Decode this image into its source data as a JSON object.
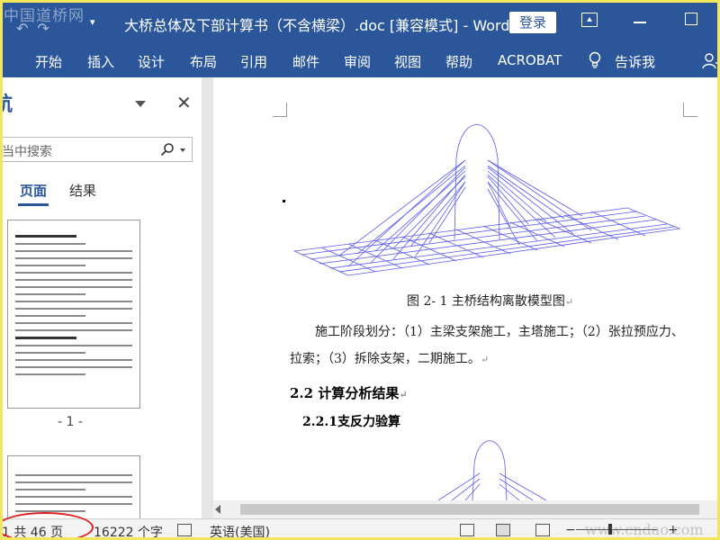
{
  "window": {
    "title": "大桥总体及下部计算书（不含横梁）.doc [兼容模式]  -  Word",
    "login_label": "登录",
    "watermark_logo": "中国道桥网"
  },
  "ribbon": {
    "tabs": [
      "开始",
      "插入",
      "设计",
      "布局",
      "引用",
      "邮件",
      "审阅",
      "视图",
      "帮助",
      "ACROBAT"
    ],
    "tell_me": "告诉我"
  },
  "nav_pane": {
    "title": "航",
    "search_placeholder": "当中搜索",
    "tabs": [
      "页面",
      "结果"
    ],
    "page_number_label": "- 1 -"
  },
  "document": {
    "figure_caption": "图 2- 1 主桥结构离散模型图",
    "paragraph_line1": "施工阶段划分：（1）主梁支架施工，主塔施工；（2）张拉预应力、",
    "paragraph_line2": "拉索；（3）拆除支架，二期施工。",
    "heading_2": "2.2 计算分析结果",
    "heading_3": "2.2.1支反力验算"
  },
  "status_bar": {
    "page_count": "1 共 46 页",
    "word_count": "16222 个字",
    "language": "英语(美国)",
    "watermark_site": "www.cndao.com"
  },
  "colors": {
    "accent": "#2b579a",
    "model_lines": "#5a5af0",
    "highlight_ellipse": "#e02020",
    "frame": "#f3e65a"
  }
}
